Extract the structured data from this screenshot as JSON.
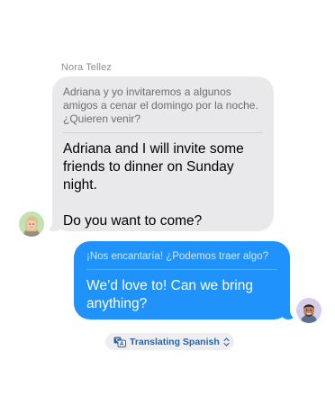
{
  "conversation": {
    "sender_name": "Nora Tellez",
    "incoming": {
      "original": "Adriana y yo invitaremos a algunos amigos a cenar el domingo por la noche. ¿Quieren venir?",
      "translation": "Adriana and I will invite some friends to dinner on Sunday night.\n\nDo you want to come?"
    },
    "outgoing": {
      "original": "¡Nos encantaría! ¿Podemos traer algo?",
      "translation": "We’d love to! Can we bring anything?"
    }
  },
  "translation_control": {
    "label": "Translating Spanish",
    "icon": "translate-icon",
    "chevron": "chevron-up-down-icon"
  },
  "colors": {
    "incoming_bubble": "#e9e9eb",
    "outgoing_bubble": "#1f93fb",
    "accent": "#2a62a8"
  }
}
